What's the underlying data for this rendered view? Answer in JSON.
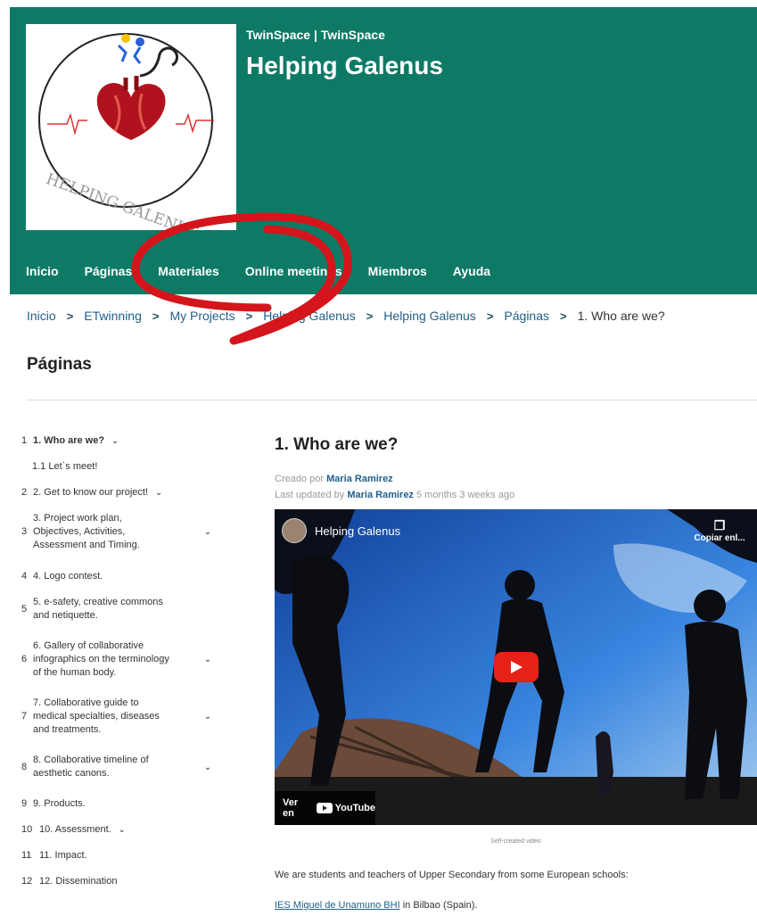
{
  "header": {
    "kicker": "TwinSpace | TwinSpace",
    "title": "Helping Galenus",
    "logo_text": "HELPING GALENUS",
    "bg_color": "#0e7a66",
    "nav": [
      "Inicio",
      "Páginas",
      "Materiales",
      "Online meetings",
      "Miembros",
      "Ayuda"
    ]
  },
  "breadcrumb": [
    "Inicio",
    "ETwinning",
    "My Projects",
    "Helping Galenus",
    "Helping Galenus",
    "Páginas",
    "1. Who are we?"
  ],
  "page_heading": "Páginas",
  "sidebar": [
    {
      "num": "1",
      "lines": [
        "1. Who are we?"
      ],
      "chevron": true,
      "bold": true
    },
    {
      "num": "",
      "lines": [
        "1.1  Let`s meet!"
      ],
      "chevron": false,
      "bold": false,
      "indent": true
    },
    {
      "num": "2",
      "lines": [
        "2. Get to know our project!"
      ],
      "chevron": true,
      "bold": false
    },
    {
      "num": "3",
      "lines": [
        "3. Project work plan,",
        "Objectives, Activities,",
        "Assessment and Timing."
      ],
      "chevron": true,
      "bold": false
    },
    {
      "num": "4",
      "lines": [
        "4. Logo contest."
      ],
      "chevron": false,
      "bold": false
    },
    {
      "num": "5",
      "lines": [
        "5. e-safety, creative commons",
        "and netiquette."
      ],
      "chevron": false,
      "bold": false
    },
    {
      "num": "6",
      "lines": [
        "6. Gallery of collaborative",
        "infographics on the terminology",
        "of the human body."
      ],
      "chevron": true,
      "bold": false
    },
    {
      "num": "7",
      "lines": [
        "7. Collaborative guide to",
        "medical specialties, diseases",
        "and treatments."
      ],
      "chevron": true,
      "bold": false
    },
    {
      "num": "8",
      "lines": [
        "8. Collaborative timeline of",
        "aesthetic canons."
      ],
      "chevron": true,
      "bold": false
    },
    {
      "num": "9",
      "lines": [
        "9. Products."
      ],
      "chevron": false,
      "bold": false
    },
    {
      "num": "10",
      "lines": [
        "10. Assessment."
      ],
      "chevron": true,
      "bold": false
    },
    {
      "num": "11",
      "lines": [
        "11. Impact."
      ],
      "chevron": false,
      "bold": false
    },
    {
      "num": "12",
      "lines": [
        "12. Dissemination"
      ],
      "chevron": false,
      "bold": false
    }
  ],
  "article": {
    "title": "1. Who are we?",
    "created_prefix": "Creado por ",
    "created_author": "Maria Ramirez",
    "updated_prefix": "Last updated by ",
    "updated_author": "Maria Ramirez",
    "updated_suffix": " 5 months 3 weeks ago",
    "video": {
      "title": "Helping Galenus",
      "copy_label": "Copiar enl...",
      "watch_label": "Ver en",
      "youtube_label": "YouTube"
    },
    "caption": "Self-created video",
    "paragraph": "We are students and teachers of Upper Secondary from some European schools:",
    "school_link": "IES Miguel de Unamuno BHI",
    "school_suffix": " in Bilbao (Spain)."
  }
}
